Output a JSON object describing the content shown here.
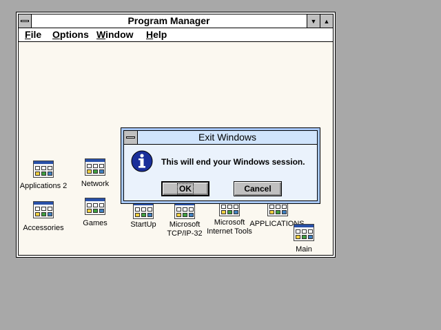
{
  "program_manager": {
    "title": "Program Manager",
    "menu": [
      {
        "label": "File",
        "accel": "F",
        "rest": "ile"
      },
      {
        "label": "Options",
        "accel": "O",
        "rest": "ptions"
      },
      {
        "label": "Window",
        "accel": "W",
        "rest": "indow"
      },
      {
        "label": "Help",
        "accel": "H",
        "rest": "elp"
      }
    ],
    "groups": [
      {
        "label": "Applications 2"
      },
      {
        "label": "Network"
      },
      {
        "label": "Accessories"
      },
      {
        "label": "Games"
      },
      {
        "label": "StartUp"
      },
      {
        "label1": "Microsoft",
        "label2": "TCP/IP-32"
      },
      {
        "label1": "Microsoft",
        "label2": "Internet Tools"
      },
      {
        "label": "APPLICATIONS"
      },
      {
        "label": "Main"
      }
    ]
  },
  "dialog": {
    "title": "Exit Windows",
    "message": "This will end your Windows session.",
    "ok_label": "OK",
    "cancel_label": "Cancel",
    "icon": "information-icon"
  },
  "colors": {
    "desktop": "#a8a8a8",
    "dialog_title": "#d0e4fc",
    "info_icon": "#1a2f9a"
  }
}
